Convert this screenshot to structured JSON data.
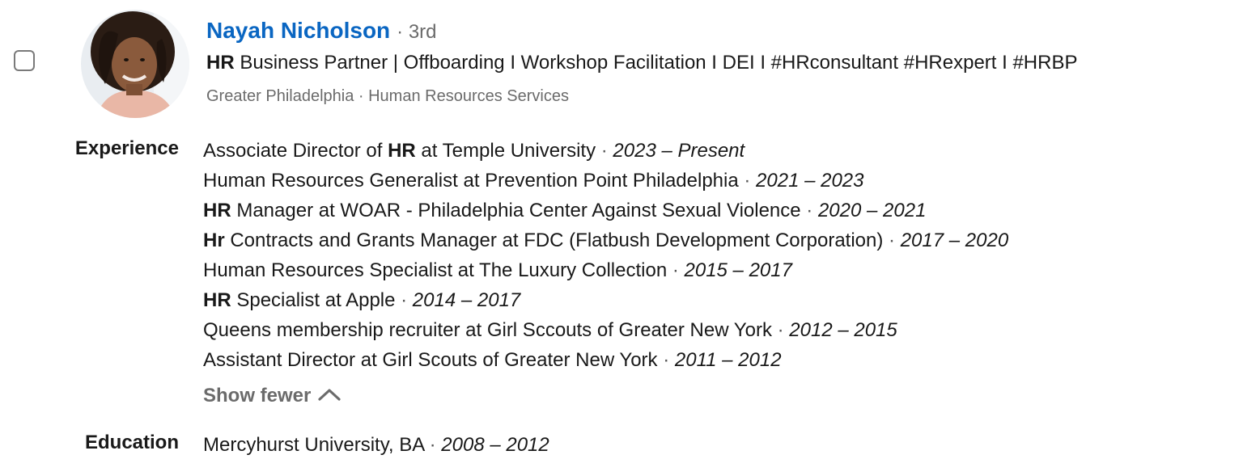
{
  "profile": {
    "name": "Nayah Nicholson",
    "degree": "· 3rd",
    "headline_bold": "HR",
    "headline_rest": " Business Partner | Offboarding I Workshop Facilitation I DEI I #HRconsultant #HRexpert I #HRBP",
    "location": "Greater Philadelphia · Human Resources Services"
  },
  "experience": {
    "label": "Experience",
    "items": [
      {
        "pre": "",
        "bold": "",
        "post": "Associate Director of ",
        "bold2": "HR",
        "post2": " at Temple University",
        "dates": "2023 – Present"
      },
      {
        "pre": "",
        "bold": "",
        "post": "Human Resources Generalist at Prevention Point Philadelphia",
        "bold2": "",
        "post2": "",
        "dates": "2021 – 2023"
      },
      {
        "pre": "",
        "bold": "HR",
        "post": " Manager at WOAR - Philadelphia Center Against Sexual Violence",
        "bold2": "",
        "post2": "",
        "dates": "2020 – 2021"
      },
      {
        "pre": "",
        "bold": "Hr",
        "post": " Contracts and Grants Manager at FDC (Flatbush Development Corporation)",
        "bold2": "",
        "post2": "",
        "dates": "2017 – 2020"
      },
      {
        "pre": "",
        "bold": "",
        "post": "Human Resources Specialist at The Luxury Collection",
        "bold2": "",
        "post2": "",
        "dates": "2015 – 2017"
      },
      {
        "pre": "",
        "bold": "HR",
        "post": " Specialist at Apple",
        "bold2": "",
        "post2": "",
        "dates": "2014 – 2017"
      },
      {
        "pre": "",
        "bold": "",
        "post": "Queens membership recruiter at Girl Sccouts of Greater New York",
        "bold2": "",
        "post2": "",
        "dates": "2012 – 2015"
      },
      {
        "pre": "",
        "bold": "",
        "post": "Assistant Director at Girl Scouts of Greater New York",
        "bold2": "",
        "post2": "",
        "dates": "2011 – 2012"
      }
    ],
    "toggle_label": "Show fewer",
    "toggle_icon": "chevron-up-icon"
  },
  "education": {
    "label": "Education",
    "school": "Mercyhurst University, BA",
    "dates": "2008 – 2012"
  },
  "colors": {
    "name_link": "#0a66c2",
    "muted": "#6b6b6b"
  }
}
